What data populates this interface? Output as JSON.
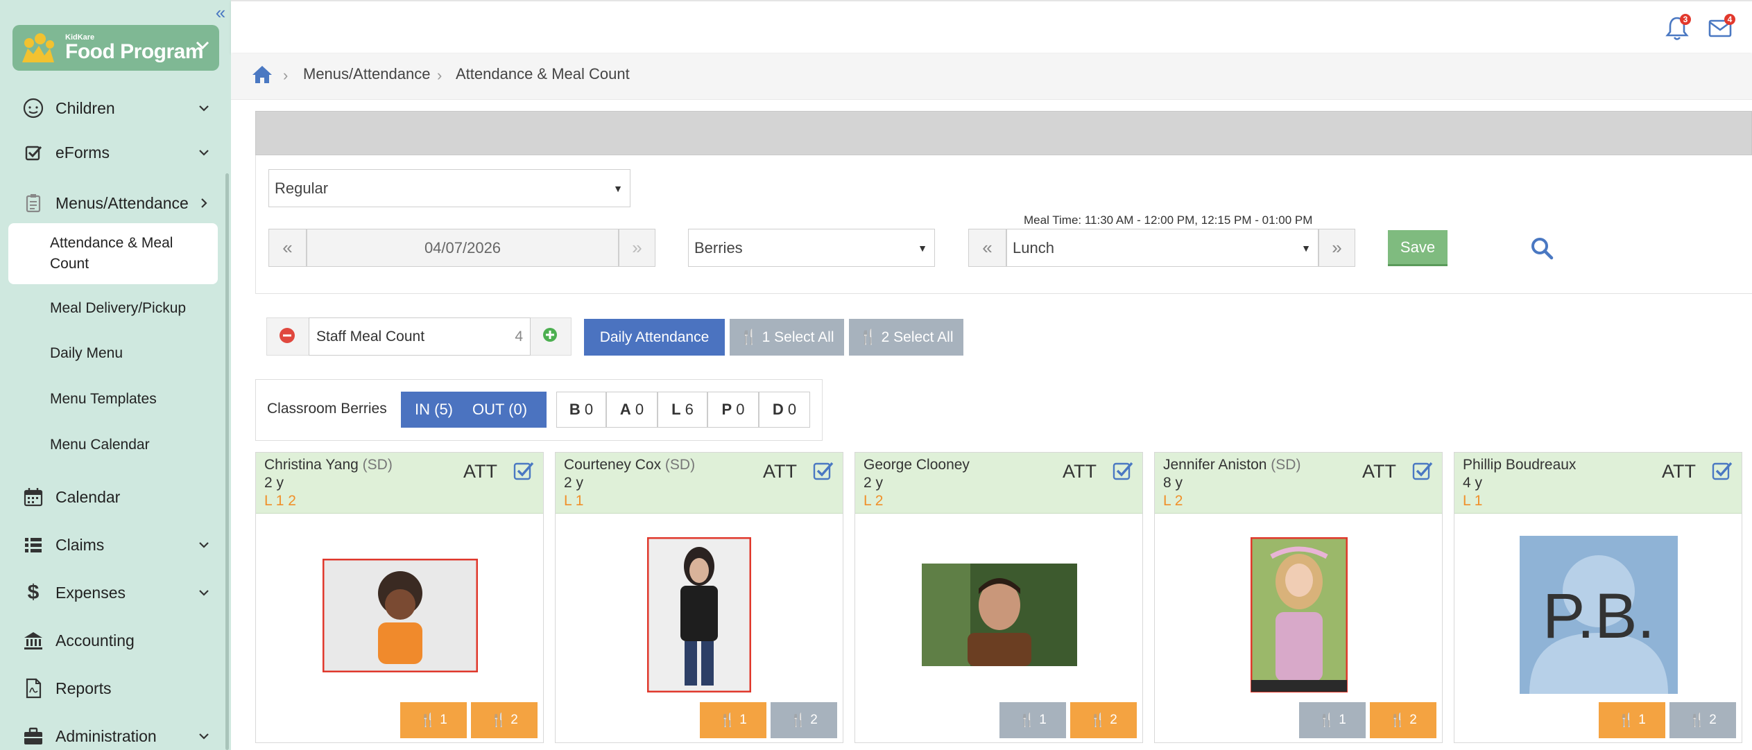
{
  "brand": {
    "small": "KidKare",
    "big": "Food Program"
  },
  "nav": {
    "children": "Children",
    "eforms": "eForms",
    "menus": "Menus/Attendance",
    "sub": [
      "Attendance & Meal Count",
      "Meal Delivery/Pickup",
      "Daily Menu",
      "Menu Templates",
      "Menu Calendar"
    ],
    "calendar": "Calendar",
    "claims": "Claims",
    "expenses": "Expenses",
    "accounting": "Accounting",
    "reports": "Reports",
    "administration": "Administration"
  },
  "topbar": {
    "notif_count": "3",
    "mail_count": "4"
  },
  "breadcrumb": {
    "level1": "Menus/Attendance",
    "level2": "Attendance & Meal Count"
  },
  "filters": {
    "type": "Regular",
    "date": "04/07/2026",
    "classroom": "Berries",
    "meal_time": "Meal Time: 11:30 AM - 12:00 PM, 12:15 PM - 01:00 PM",
    "meal": "Lunch",
    "save": "Save"
  },
  "staff": {
    "label": "Staff Meal Count",
    "count": "4"
  },
  "actions": {
    "daily_attendance": "Daily Attendance",
    "select1": "1 Select All",
    "select2": "2 Select All"
  },
  "classroom": {
    "label": "Classroom Berries",
    "in": "IN (5)",
    "out": "OUT (0)",
    "counts": [
      {
        "key": "B",
        "val": "0"
      },
      {
        "key": "A",
        "val": "0"
      },
      {
        "key": "L",
        "val": "6"
      },
      {
        "key": "P",
        "val": "0"
      },
      {
        "key": "D",
        "val": "0"
      }
    ]
  },
  "children": [
    {
      "name": "Christina Yang",
      "sd": "(SD)",
      "age": "2 y",
      "meals": "L 1 2",
      "att": "ATT",
      "m1": "1",
      "m2": "2",
      "m1_on": true,
      "m2_on": true
    },
    {
      "name": "Courteney Cox",
      "sd": "(SD)",
      "age": "2 y",
      "meals": "L 1",
      "att": "ATT",
      "m1": "1",
      "m2": "2",
      "m1_on": true,
      "m2_on": false
    },
    {
      "name": "George Clooney",
      "sd": "",
      "age": "2 y",
      "meals": "L 2",
      "att": "ATT",
      "m1": "1",
      "m2": "2",
      "m1_on": false,
      "m2_on": true
    },
    {
      "name": "Jennifer Aniston",
      "sd": "(SD)",
      "age": "8 y",
      "meals": "L 2",
      "att": "ATT",
      "m1": "1",
      "m2": "2",
      "m1_on": false,
      "m2_on": true
    },
    {
      "name": "Phillip Boudreaux",
      "sd": "",
      "age": "4 y",
      "meals": "L 1",
      "att": "ATT",
      "m1": "1",
      "m2": "2",
      "m1_on": true,
      "m2_on": false,
      "initials": "P.B."
    }
  ],
  "colors": {
    "sidebar": "#cfe8df",
    "brand": "#7fb894",
    "accent_blue": "#4b73c0",
    "meal_orange": "#f4a341",
    "card_header": "#dff0d8",
    "save_green": "#7fbb7f"
  }
}
